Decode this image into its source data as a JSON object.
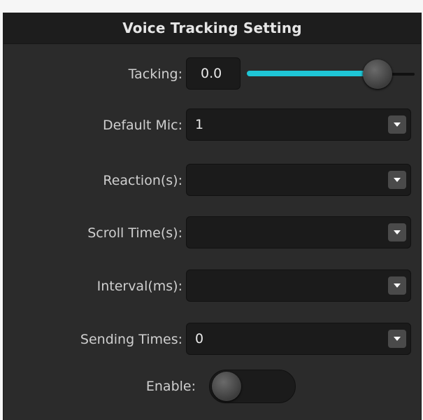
{
  "panel": {
    "title": "Voice Tracking Setting"
  },
  "tracking": {
    "label": "Tacking:",
    "value": "0.0",
    "slider_level": 0.78,
    "accent": "#1fc6d6"
  },
  "default_mic": {
    "label": "Default Mic:",
    "value": "1"
  },
  "reaction": {
    "label": "Reaction(s):",
    "value": ""
  },
  "scroll_time": {
    "label": "Scroll Time(s):",
    "value": ""
  },
  "interval": {
    "label": "Interval(ms):",
    "value": ""
  },
  "sending_times": {
    "label": "Sending Times:",
    "value": "0"
  },
  "enable": {
    "label": "Enable:",
    "on": false
  }
}
